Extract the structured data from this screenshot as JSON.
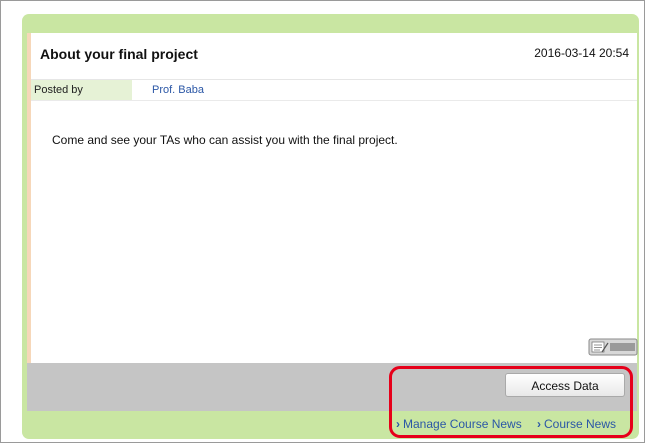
{
  "post": {
    "title": "About your final project",
    "date": "2016-03-14 20:54",
    "posted_by_label": "Posted by",
    "author": "Prof. Baba",
    "body": "Come and see your TAs who can assist you with the final project.",
    "memo_icon": "memo-icon"
  },
  "actions": {
    "access_data_label": "Access Data"
  },
  "footer_links": [
    {
      "label": "Manage Course News",
      "icon": "chevron-right-icon"
    },
    {
      "label": "Course News",
      "icon": "chevron-right-icon"
    }
  ],
  "colors": {
    "frame_green": "#c9e6a2",
    "posted_label_bg": "#e6f2d6",
    "link_blue": "#2b57a6",
    "highlight_red": "#e6001a",
    "action_bar_gray": "#c5c5c5"
  }
}
